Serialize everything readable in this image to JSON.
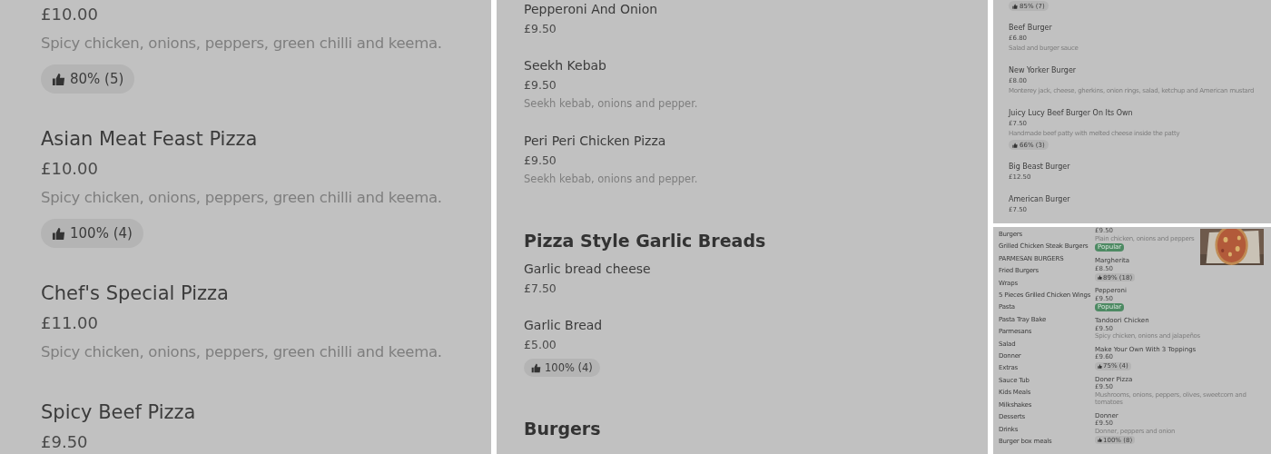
{
  "panels": [
    {
      "entries": [
        {
          "kind": "item",
          "price": "£10.00",
          "description": "Spicy chicken, onions, peppers, green chilli and keema.",
          "rating": "80% (5)"
        },
        {
          "kind": "item",
          "name": "Asian Meat Feast Pizza",
          "price": "£10.00",
          "description": "Spicy chicken, onions, peppers, green chilli and keema.",
          "rating": "100% (4)"
        },
        {
          "kind": "item",
          "name": "Chef's Special Pizza",
          "price": "£11.00",
          "description": "Spicy chicken, onions, peppers, green chilli and keema."
        },
        {
          "kind": "item",
          "name": "Spicy Beef Pizza",
          "price": "£9.50"
        }
      ]
    },
    {
      "entries": [
        {
          "kind": "item",
          "name": "Pepperoni And Onion",
          "price": "£9.50"
        },
        {
          "kind": "item",
          "name": "Seekh Kebab",
          "price": "£9.50",
          "description": "Seekh kebab, onions and pepper."
        },
        {
          "kind": "item",
          "name": "Peri Peri Chicken Pizza",
          "price": "£9.50",
          "description": "Seekh kebab, onions and pepper."
        },
        {
          "kind": "heading",
          "name": "Pizza Style Garlic Breads"
        },
        {
          "kind": "item",
          "name": "Garlic bread cheese",
          "price": "£7.50"
        },
        {
          "kind": "item",
          "name": "Garlic Bread",
          "price": "£5.00",
          "rating": "100% (4)"
        },
        {
          "kind": "heading",
          "name": "Burgers"
        }
      ]
    },
    {
      "entries": [
        {
          "kind": "item",
          "rating": "85% (7)"
        },
        {
          "kind": "item",
          "name": "Beef Burger",
          "price": "£6.80",
          "description": "Salad and burger sauce"
        },
        {
          "kind": "item",
          "name": "New Yorker Burger",
          "price": "£8.00",
          "description": "Monterey jack, cheese, gherkins, onion rings, salad, ketchup and American mustard"
        },
        {
          "kind": "item",
          "name": "Juicy Lucy Beef Burger On Its Own",
          "price": "£7.50",
          "description": "Handmade beef patty with melted cheese inside the patty",
          "rating": "66% (3)"
        },
        {
          "kind": "item",
          "name": "Big Beast Burger",
          "price": "£12.50"
        },
        {
          "kind": "item",
          "name": "American Burger",
          "price": "£7.50"
        }
      ]
    },
    {
      "sidebar": [
        {
          "label": "Burgers"
        },
        {
          "label": "Grilled Chicken Steak Burgers"
        },
        {
          "label": "PARMESAN BURGERS"
        },
        {
          "label": "Fried Burgers"
        },
        {
          "label": "Wraps"
        },
        {
          "label": "5 Pieces Grilled Chicken Wings"
        },
        {
          "label": "Pasta"
        },
        {
          "label": "Pasta Tray Bake"
        },
        {
          "label": "Parmesans"
        },
        {
          "label": "Salad"
        },
        {
          "label": "Donner"
        },
        {
          "label": "Extras"
        },
        {
          "label": "Sauce Tub"
        },
        {
          "label": "Kids Meals"
        },
        {
          "label": "Milkshakes"
        },
        {
          "label": "Desserts"
        },
        {
          "label": "Drinks"
        },
        {
          "label": "Burger box meals"
        }
      ],
      "entries": [
        {
          "kind": "item",
          "price": "£9.50",
          "description": "Plain chicken, onions and peppers",
          "badge": "Popular"
        },
        {
          "kind": "item",
          "name": "Margherita",
          "price": "£8.50",
          "rating": "89% (18)"
        },
        {
          "kind": "item",
          "name": "Pepperoni",
          "price": "£9.50",
          "badge": "Popular"
        },
        {
          "kind": "item",
          "name": "Tandoori Chicken",
          "price": "£9.50",
          "description": "Spicy chicken, onions and jalapeños"
        },
        {
          "kind": "item",
          "name": "Make Your Own With 3 Toppings",
          "price": "£9.60",
          "rating": "75% (4)"
        },
        {
          "kind": "item",
          "name": "Doner Pizza",
          "price": "£9.50",
          "description": "Mushrooms, onions, peppers, olives, sweetcorn and tomatoes"
        },
        {
          "kind": "item",
          "name": "Donner",
          "price": "£9.50",
          "description": "Donner, peppers and onion",
          "rating": "100% (8)"
        }
      ]
    }
  ]
}
